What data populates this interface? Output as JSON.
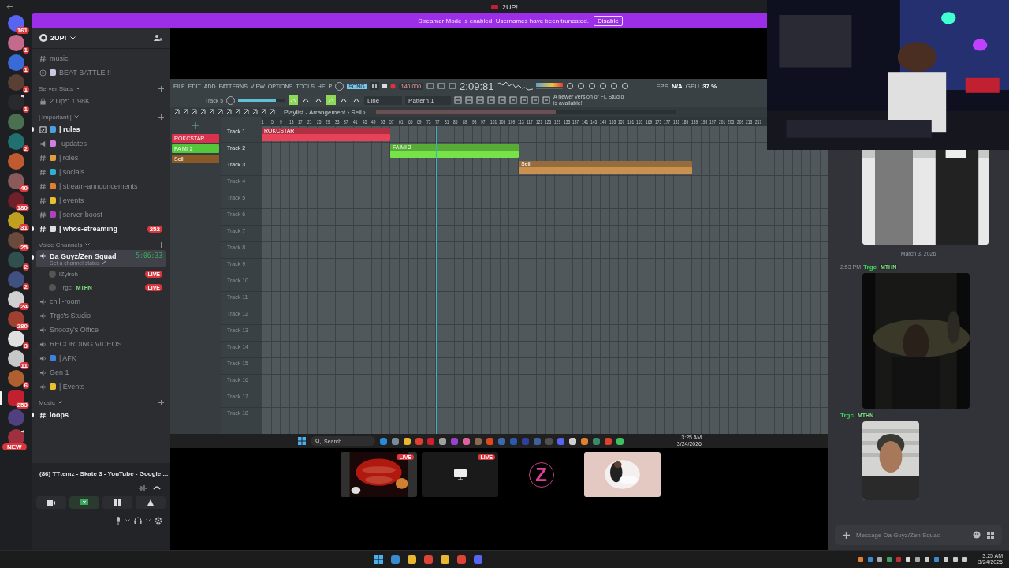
{
  "window": {
    "title": "2UP!"
  },
  "server_rail": [
    {
      "badge": "161",
      "in_voice": false,
      "selected": false
    },
    {
      "badge": "1",
      "in_voice": false,
      "selected": false
    },
    {
      "badge": "1",
      "in_voice": false,
      "selected": false
    },
    {
      "badge": "1",
      "in_voice": false,
      "selected": false
    },
    {
      "badge": "1",
      "in_voice": true,
      "selected": false
    },
    {
      "in_voice": false,
      "selected": false
    },
    {
      "badge": "2",
      "in_voice": false,
      "selected": false
    },
    {
      "in_voice": false,
      "selected": false
    },
    {
      "badge": "40",
      "in_voice": false,
      "selected": false
    },
    {
      "badge": "180",
      "in_voice": false,
      "selected": false
    },
    {
      "badge": "31",
      "in_voice": false,
      "selected": false
    },
    {
      "badge": "25",
      "in_voice": false,
      "selected": false
    },
    {
      "badge": "2",
      "in_voice": false,
      "selected": false
    },
    {
      "badge": "2",
      "in_voice": false,
      "selected": false
    },
    {
      "badge": "24",
      "in_voice": false,
      "selected": false
    },
    {
      "badge": "280",
      "in_voice": false,
      "selected": false
    },
    {
      "badge": "3",
      "in_voice": false,
      "selected": false
    },
    {
      "badge": "11",
      "in_voice": false,
      "selected": false
    },
    {
      "badge": "6",
      "in_voice": false,
      "selected": false
    },
    {
      "badge": "253",
      "in_voice": false,
      "selected": true
    },
    {
      "in_voice": false,
      "selected": false
    },
    {
      "in_voice": true,
      "selected": false
    }
  ],
  "rail_new_pill": "NEW",
  "banner": {
    "text": "Streamer Mode is enabled. Usernames have been truncated.",
    "button": "Disable"
  },
  "sidebar": {
    "server_name": "2UP!",
    "channels": [
      {
        "kind": "text",
        "name": "music",
        "unread": false
      },
      {
        "kind": "stage",
        "name": "BEAT BATTLE !!",
        "unread": false,
        "color": "#c8c8e0"
      },
      {
        "kind": "category",
        "name": "Server Stats"
      },
      {
        "kind": "locked",
        "name": "2 Up*: 1.98K",
        "unread": false
      },
      {
        "kind": "category",
        "name": "| important |"
      },
      {
        "kind": "rules",
        "name": "| rules",
        "unread": true,
        "color": "#4aa0e0"
      },
      {
        "kind": "announce",
        "name": "-updates",
        "unread": false,
        "color": "#d080e0"
      },
      {
        "kind": "text",
        "name": "| roles",
        "unread": false,
        "color": "#e0a040"
      },
      {
        "kind": "text",
        "name": "| socials",
        "unread": false,
        "color": "#30b0d0"
      },
      {
        "kind": "text",
        "name": "| stream-announcements",
        "unread": false,
        "color": "#e08030"
      },
      {
        "kind": "text",
        "name": "| events",
        "unread": false,
        "color": "#e8c030"
      },
      {
        "kind": "text",
        "name": "| server-boost",
        "unread": false,
        "color": "#b040c0"
      },
      {
        "kind": "text",
        "name": "| whos-streaming",
        "unread": true,
        "color": "#e0e0e0",
        "badge": "252"
      },
      {
        "kind": "category",
        "name": "Voice Channels"
      },
      {
        "kind": "voice",
        "name": "Da Guyz/Zen Squad",
        "unread": true,
        "selected": true,
        "timer": "5:06:33",
        "status": "Set a channel status"
      },
      {
        "kind": "voice_user",
        "name": "lZyiroh",
        "live": "LIVE"
      },
      {
        "kind": "voice_user",
        "name": "Trgc",
        "tag": "MTHN",
        "live": "LIVE"
      },
      {
        "kind": "voice",
        "name": "chill-room",
        "unread": false,
        "selected": false
      },
      {
        "kind": "voice",
        "name": "Trgc's Studio",
        "unread": false,
        "selected": false
      },
      {
        "kind": "voice",
        "name": "Snoozy's Office",
        "unread": false,
        "selected": false
      },
      {
        "kind": "voice",
        "name": "RECORDING VIDEOS",
        "unread": false,
        "selected": false
      },
      {
        "kind": "voice",
        "name": "| AFK",
        "unread": false,
        "selected": false,
        "color": "#4080e0"
      },
      {
        "kind": "voice",
        "name": "Gen 1",
        "unread": false,
        "selected": false
      },
      {
        "kind": "voice",
        "name": "| Events",
        "unread": false,
        "selected": false,
        "color": "#e8c030"
      },
      {
        "kind": "category",
        "name": "Music"
      },
      {
        "kind": "text",
        "name": "loops",
        "unread": true
      }
    ]
  },
  "voice_panel": {
    "stream": "(86) TTtemz - Skate 3 - YouTube - Google ...",
    "screen_share_on": true
  },
  "fl": {
    "menu": [
      "FILE",
      "EDIT",
      "ADD",
      "PATTERNS",
      "VIEW",
      "OPTIONS",
      "TOOLS",
      "HELP"
    ],
    "song_mode": "SONG",
    "tempo": "140.000",
    "time": "2:09:81",
    "fps_label": "FPS",
    "fps": "N/A",
    "gpu_label": "GPU",
    "gpu": "37 %",
    "track_hint": "Track 5",
    "master": {
      "level": 0.8
    },
    "snap": "Line",
    "pattern": "Pattern 1",
    "news": "A newer version of FL Studio is available!",
    "breadcrumb": "Playlist - Arrangement › Seil ›",
    "patterns": [
      {
        "name": "ROKCSTAR",
        "color": "#d8324c"
      },
      {
        "name": "FA MI 2",
        "color": "#52c83a"
      },
      {
        "name": "Seil",
        "color": "#8a5a26"
      }
    ],
    "ruler": [
      "1",
      "5",
      "9",
      "13",
      "17",
      "21",
      "25",
      "29",
      "33",
      "37",
      "41",
      "45",
      "49",
      "53",
      "57",
      "61",
      "65",
      "69",
      "73",
      "77",
      "81",
      "85",
      "89",
      "93",
      "97",
      "101",
      "105",
      "109",
      "113",
      "117",
      "121",
      "125",
      "129",
      "133",
      "137",
      "141",
      "145",
      "149",
      "153",
      "157",
      "161",
      "165",
      "169",
      "173",
      "177",
      "181",
      "185",
      "189",
      "193",
      "197",
      "201",
      "205",
      "209",
      "213",
      "217"
    ],
    "tracks": [
      {
        "name": "Track 1",
        "active": true
      },
      {
        "name": "Track 2",
        "active": true
      },
      {
        "name": "Track 3",
        "active": true
      },
      {
        "name": "Track 4",
        "active": false
      },
      {
        "name": "Track 5",
        "active": false
      },
      {
        "name": "Track 6",
        "active": false
      },
      {
        "name": "Track 7",
        "active": false
      },
      {
        "name": "Track 8",
        "active": false
      },
      {
        "name": "Track 9",
        "active": false
      },
      {
        "name": "Track 10",
        "active": false
      },
      {
        "name": "Track 11",
        "active": false
      },
      {
        "name": "Track 12",
        "active": false
      },
      {
        "name": "Track 13",
        "active": false
      },
      {
        "name": "Track 14",
        "active": false
      },
      {
        "name": "Track 15",
        "active": false
      },
      {
        "name": "Track 16",
        "active": false
      },
      {
        "name": "Track 17",
        "active": false
      },
      {
        "name": "Track 18",
        "active": false
      }
    ],
    "clips": [
      {
        "name": "ROKCSTAR",
        "color": "#e8415a"
      },
      {
        "name": "FA MI 2",
        "color": "#76e448"
      },
      {
        "name": "Seil",
        "color": "#c99050"
      }
    ]
  },
  "shared_taskbar": {
    "search": "Search",
    "time": "3:25 AM",
    "date": "3/24/2026"
  },
  "thumbnails": [
    {
      "kind": "picture",
      "live": "LIVE"
    },
    {
      "kind": "screen",
      "live": "LIVE"
    },
    {
      "kind": "logo",
      "text": "Z"
    },
    {
      "kind": "picture"
    }
  ],
  "webcam": {
    "kind": "picture"
  },
  "chat": {
    "top_attachment": {
      "kind": "picture"
    },
    "date": "March 3, 2026",
    "messages": [
      {
        "time": "2:53 PM",
        "author": "Trgc",
        "tag": "MTHN",
        "attachment": {
          "kind": "picture"
        }
      },
      {
        "author": "Trgc",
        "tag": "MTHN",
        "attachment": {
          "kind": "picture"
        }
      }
    ],
    "placeholder": "Message Da Guyz/Zen Squad"
  },
  "taskbar": {
    "time": "3:25 AM",
    "date": "3/24/2026"
  }
}
